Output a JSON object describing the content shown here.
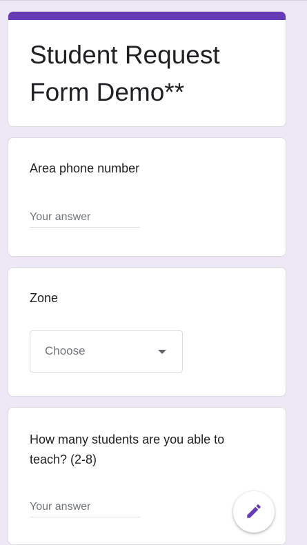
{
  "form": {
    "title": "Student Request Form Demo**",
    "accent_color": "#673ab7",
    "background_color": "#ede7f6"
  },
  "questions": [
    {
      "label": "Area phone number",
      "type": "short-answer",
      "placeholder": "Your answer"
    },
    {
      "label": "Zone",
      "type": "dropdown",
      "selected": "Choose"
    },
    {
      "label": "How many students are you able to teach? (2-8)",
      "type": "short-answer",
      "placeholder": "Your answer"
    }
  ],
  "fab": {
    "icon": "pencil-icon"
  }
}
